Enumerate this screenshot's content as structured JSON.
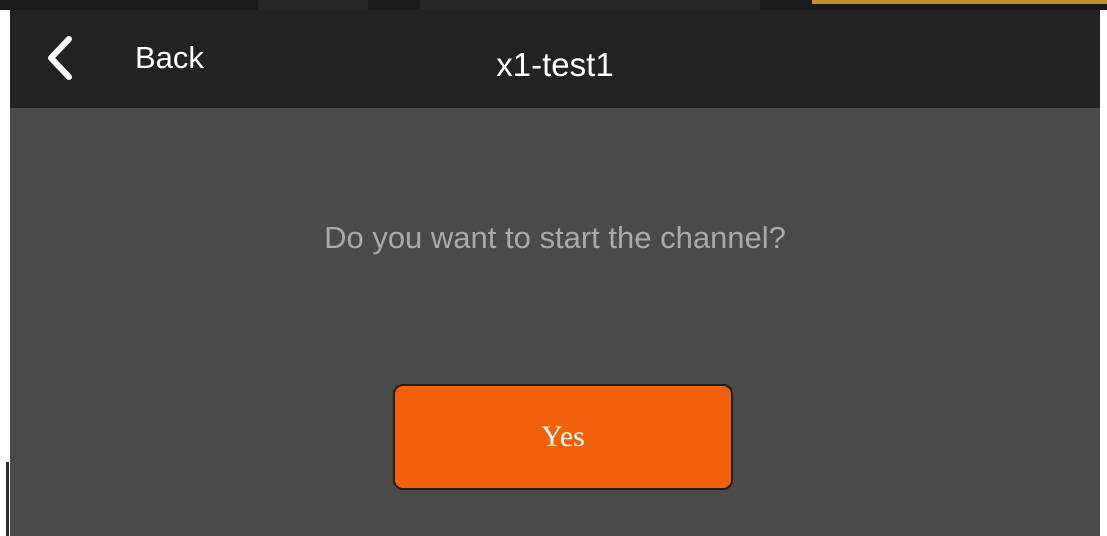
{
  "header": {
    "back_label": "Back",
    "title": "x1-test1",
    "back_icon": "chevron-left-icon"
  },
  "dialog": {
    "prompt": "Do you want to start the channel?",
    "confirm_label": "Yes"
  },
  "colors": {
    "header_background": "#222222",
    "content_background": "#4a4a4a",
    "prompt_text": "#a9a9a9",
    "button_accent": "#f2600a",
    "top_accent": "#c98b2b"
  }
}
